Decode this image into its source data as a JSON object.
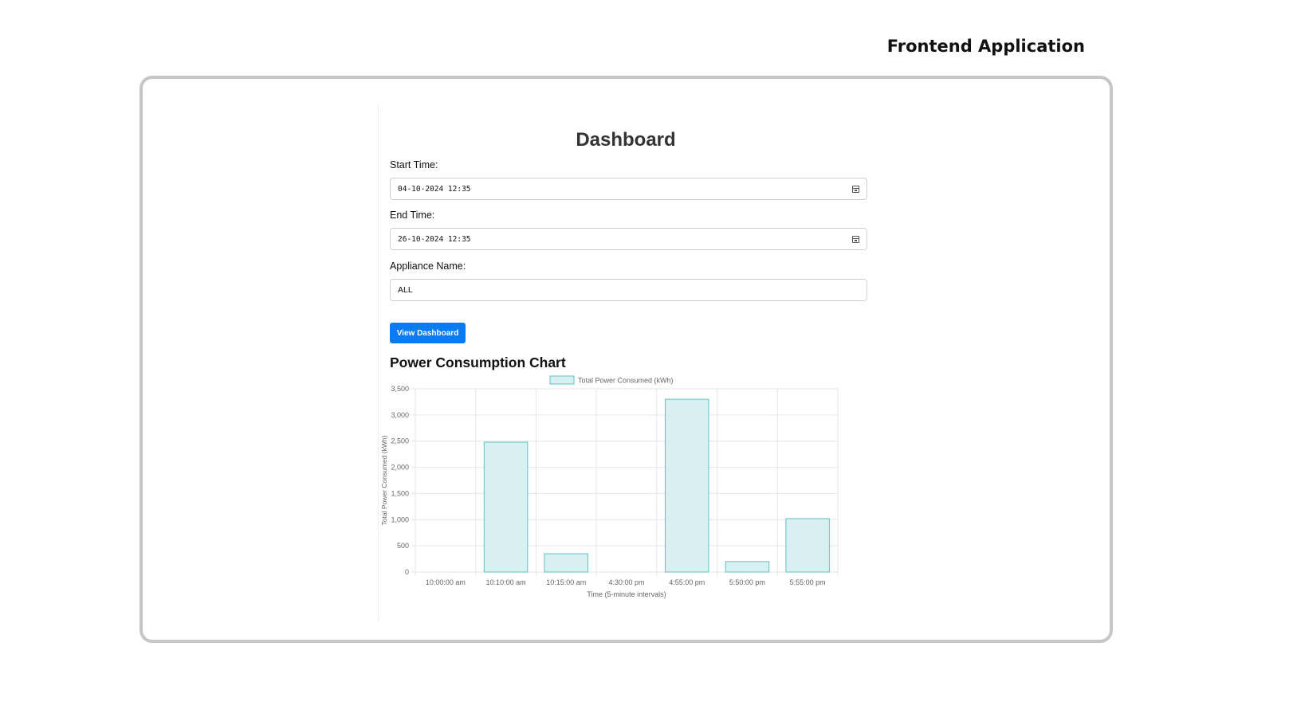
{
  "header": {
    "title": "Frontend Application"
  },
  "dashboard": {
    "title": "Dashboard",
    "start_time": {
      "label": "Start Time:",
      "value": "04-10-2024 12:35"
    },
    "end_time": {
      "label": "End Time:",
      "value": "26-10-2024 12:35"
    },
    "appliance": {
      "label": "Appliance Name:",
      "value": "ALL"
    },
    "button_label": "View Dashboard",
    "chart_heading": "Power Consumption Chart"
  },
  "chart_data": {
    "type": "bar",
    "categories": [
      "10:00:00 am",
      "10:10:00 am",
      "10:15:00 am",
      "4:30:00 pm",
      "4:55:00 pm",
      "5:50:00 pm",
      "5:55:00 pm"
    ],
    "series": [
      {
        "name": "Total Power Consumed (kWh)",
        "values": [
          0,
          2480,
          350,
          0,
          3300,
          200,
          1020
        ]
      }
    ],
    "xlabel": "Time (5-minute intervals)",
    "ylabel": "Total Power Consumed (kWh)",
    "ylim": [
      0,
      3500
    ],
    "yticks": [
      "0",
      "500",
      "1,000",
      "1,500",
      "2,000",
      "2,500",
      "3,000",
      "3,500"
    ],
    "grid": true,
    "legend_position": "top",
    "colors": {
      "fill": "#d8f0f1",
      "stroke": "#5fc2c5",
      "grid": "#e6e6e6"
    }
  }
}
